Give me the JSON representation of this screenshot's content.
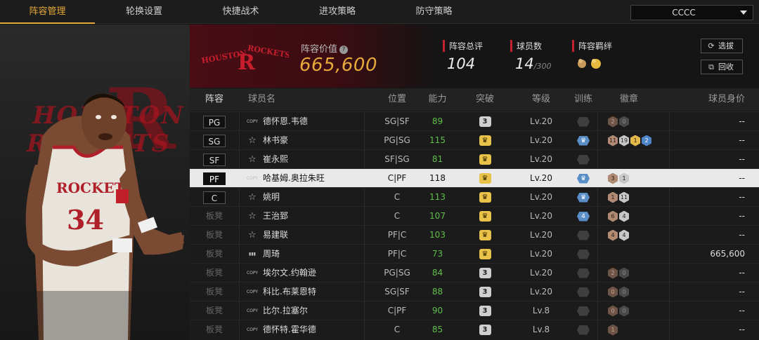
{
  "nav": {
    "tabs": [
      "阵容管理",
      "轮换设置",
      "快捷战术",
      "进攻策略",
      "防守策略"
    ],
    "active": 0,
    "team_select": "CCCC"
  },
  "header": {
    "logo_text": "HOUSTON ROCKETS",
    "lineup_value_label": "阵容价值",
    "lineup_value": "665,600",
    "total_rating_label": "阵容总评",
    "total_rating": "104",
    "player_count_label": "球员数",
    "player_count": "14",
    "player_count_max": "/300",
    "chemistry_label": "阵容羁绊",
    "select_button": "选拔",
    "recycle_button": "回收"
  },
  "table": {
    "columns": [
      "阵容",
      "球员名",
      "位置",
      "能力",
      "突破",
      "等级",
      "训练",
      "徽章",
      "球员身价"
    ],
    "rows": [
      {
        "slot": "PG",
        "bench": false,
        "icon": "copy",
        "name": "德怀恩.韦德",
        "positions": "SG|SF",
        "ability": "89",
        "ability_color": "#5fbf4a",
        "breakthrough": "3",
        "breakthrough_style": "gray",
        "level": "Lv.20",
        "training": "",
        "training_style": "dark",
        "badges": [
          {
            "v": "2",
            "c": "darkbronze"
          },
          {
            "v": "0",
            "c": "dark"
          }
        ],
        "price": "--",
        "highlight": false
      },
      {
        "slot": "SG",
        "bench": false,
        "icon": "star",
        "name": "林书豪",
        "positions": "PG|SG",
        "ability": "115",
        "ability_color": "#5fbf4a",
        "breakthrough": "♛",
        "breakthrough_style": "gold",
        "level": "Lv.20",
        "training": "♛",
        "training_style": "blue",
        "badges": [
          {
            "v": "11",
            "c": "bronze"
          },
          {
            "v": "19",
            "c": "silver"
          },
          {
            "v": "1",
            "c": "gold"
          },
          {
            "v": "2",
            "c": "blue"
          }
        ],
        "price": "--",
        "highlight": false
      },
      {
        "slot": "SF",
        "bench": false,
        "icon": "star",
        "name": "崔永熙",
        "positions": "SF|SG",
        "ability": "81",
        "ability_color": "#5fbf4a",
        "breakthrough": "♛",
        "breakthrough_style": "gold",
        "level": "Lv.20",
        "training": "",
        "training_style": "dark",
        "badges": [],
        "price": "--",
        "highlight": false
      },
      {
        "slot": "PF",
        "bench": false,
        "icon": "copy",
        "name": "哈基姆.奥拉朱旺",
        "positions": "C|PF",
        "ability": "118",
        "ability_color": "#111111",
        "breakthrough": "♛",
        "breakthrough_style": "gold",
        "level": "Lv.20",
        "training": "♛",
        "training_style": "blue",
        "badges": [
          {
            "v": "3",
            "c": "bronze"
          },
          {
            "v": "1",
            "c": "silver"
          }
        ],
        "price": "--",
        "highlight": true
      },
      {
        "slot": "C",
        "bench": false,
        "icon": "star",
        "name": "姚明",
        "positions": "C",
        "ability": "113",
        "ability_color": "#5fbf4a",
        "breakthrough": "♛",
        "breakthrough_style": "gold",
        "level": "Lv.20",
        "training": "♛",
        "training_style": "blue",
        "badges": [
          {
            "v": "1",
            "c": "bronze"
          },
          {
            "v": "11",
            "c": "silver"
          }
        ],
        "price": "--",
        "highlight": false
      },
      {
        "slot": "板凳",
        "bench": true,
        "icon": "star",
        "name": "王治郅",
        "positions": "C",
        "ability": "107",
        "ability_color": "#5fbf4a",
        "breakthrough": "♛",
        "breakthrough_style": "gold",
        "level": "Lv.20",
        "training": "4",
        "training_style": "blue",
        "badges": [
          {
            "v": "6",
            "c": "bronze"
          },
          {
            "v": "4",
            "c": "silver"
          }
        ],
        "price": "--",
        "highlight": false
      },
      {
        "slot": "板凳",
        "bench": true,
        "icon": "star",
        "name": "易建联",
        "positions": "PF|C",
        "ability": "103",
        "ability_color": "#5fbf4a",
        "breakthrough": "♛",
        "breakthrough_style": "gold",
        "level": "Lv.20",
        "training": "",
        "training_style": "dark",
        "badges": [
          {
            "v": "4",
            "c": "bronze"
          },
          {
            "v": "4",
            "c": "silver"
          }
        ],
        "price": "--",
        "highlight": false
      },
      {
        "slot": "板凳",
        "bench": true,
        "icon": "chart",
        "name": "周琦",
        "positions": "PF|C",
        "ability": "73",
        "ability_color": "#5fbf4a",
        "breakthrough": "♛",
        "breakthrough_style": "gold",
        "level": "Lv.20",
        "training": "",
        "training_style": "dark",
        "badges": [],
        "price": "665,600",
        "highlight": false
      },
      {
        "slot": "板凳",
        "bench": true,
        "icon": "copy",
        "name": "埃尔文.约翰逊",
        "positions": "PG|SG",
        "ability": "84",
        "ability_color": "#5fbf4a",
        "breakthrough": "3",
        "breakthrough_style": "gray",
        "level": "Lv.20",
        "training": "",
        "training_style": "dark",
        "badges": [
          {
            "v": "2",
            "c": "darkbronze"
          },
          {
            "v": "0",
            "c": "dark"
          }
        ],
        "price": "--",
        "highlight": false
      },
      {
        "slot": "板凳",
        "bench": true,
        "icon": "copy",
        "name": "科比.布莱恩特",
        "positions": "SG|SF",
        "ability": "88",
        "ability_color": "#5fbf4a",
        "breakthrough": "3",
        "breakthrough_style": "gray",
        "level": "Lv.20",
        "training": "",
        "training_style": "dark",
        "badges": [
          {
            "v": "0",
            "c": "darkbronze"
          },
          {
            "v": "0",
            "c": "dark"
          }
        ],
        "price": "--",
        "highlight": false
      },
      {
        "slot": "板凳",
        "bench": true,
        "icon": "copy",
        "name": "比尔.拉塞尔",
        "positions": "C|PF",
        "ability": "90",
        "ability_color": "#5fbf4a",
        "breakthrough": "3",
        "breakthrough_style": "gray",
        "level": "Lv.8",
        "training": "",
        "training_style": "dark",
        "badges": [
          {
            "v": "0",
            "c": "darkbronze"
          },
          {
            "v": "0",
            "c": "dark"
          }
        ],
        "price": "--",
        "highlight": false
      },
      {
        "slot": "板凳",
        "bench": true,
        "icon": "copy",
        "name": "德怀特.霍华德",
        "positions": "C",
        "ability": "85",
        "ability_color": "#5fbf4a",
        "breakthrough": "3",
        "breakthrough_style": "gray",
        "level": "Lv.8",
        "training": "",
        "training_style": "dark",
        "badges": [
          {
            "v": "1",
            "c": "darkbronze"
          }
        ],
        "price": "--",
        "highlight": false
      }
    ]
  }
}
